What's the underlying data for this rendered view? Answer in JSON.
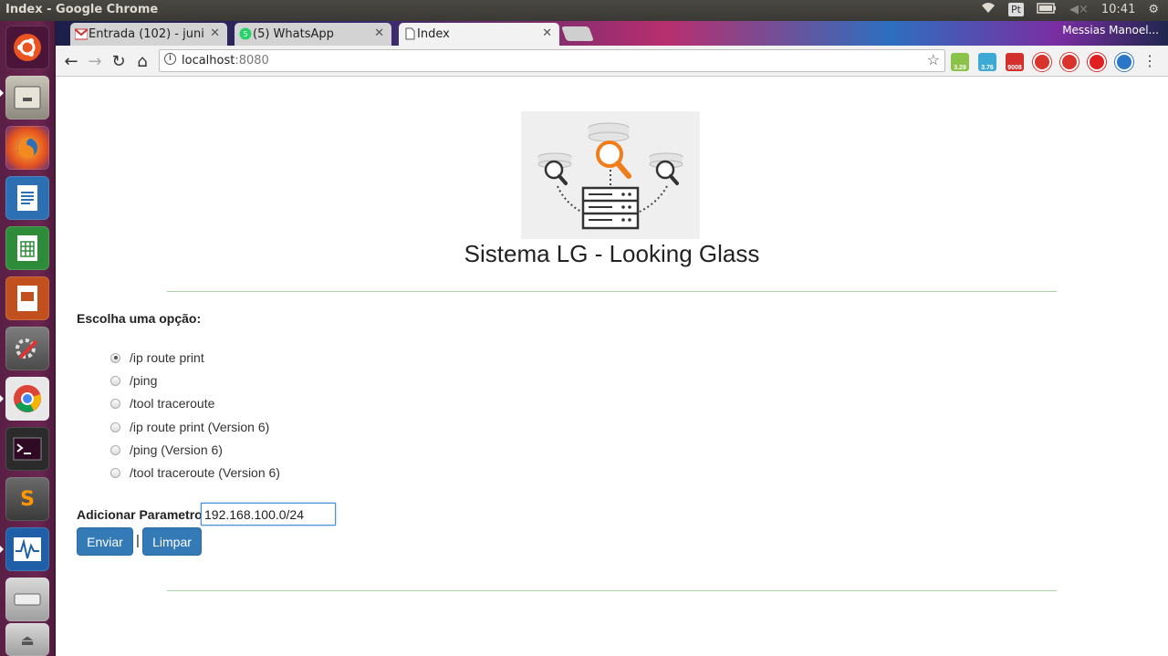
{
  "window": {
    "title": "Index - Google Chrome"
  },
  "tray": {
    "keyboard": "Pt",
    "time": "10:41"
  },
  "tabs": [
    {
      "label": "Entrada (102) - juni",
      "favicon": "gmail-icon"
    },
    {
      "label": "(5) WhatsApp",
      "favicon": "whatsapp-icon"
    },
    {
      "label": "Index",
      "favicon": "page-icon"
    }
  ],
  "profile": "Messias Manoel...",
  "address": {
    "host": "localhost",
    "port": ":8080"
  },
  "extensions": [
    {
      "name": "android-ext-icon",
      "badge": "3.29",
      "color": "#8bc34a"
    },
    {
      "name": "android-ext-icon-2",
      "badge": "3.76",
      "color": "#3fa9d6"
    },
    {
      "name": "gmail-ext-icon",
      "badge": "9008",
      "color": "#d32f2f"
    },
    {
      "name": "ext-icon-red-1",
      "badge": "",
      "color": "#d9342b"
    },
    {
      "name": "ext-icon-red-2",
      "badge": "",
      "color": "#d9342b"
    },
    {
      "name": "opera-ext-icon",
      "badge": "",
      "color": "#e02020"
    },
    {
      "name": "vpn-ext-icon",
      "badge": "",
      "color": "#2a77c9"
    }
  ],
  "page": {
    "heading": "Sistema LG - Looking Glass",
    "choose_label": "Escolha uma opção:",
    "options": [
      {
        "label": "/ip route print",
        "selected": true
      },
      {
        "label": "/ping",
        "selected": false
      },
      {
        "label": "/tool traceroute",
        "selected": false
      },
      {
        "label": "/ip route print (Version 6)",
        "selected": false
      },
      {
        "label": "/ping (Version 6)",
        "selected": false
      },
      {
        "label": "/tool traceroute (Version 6)",
        "selected": false
      }
    ],
    "param_label": "Adicionar Parametro:",
    "param_value": "192.168.100.0/24",
    "send_button": "Enviar",
    "separator": "|",
    "clear_button": "Limpar"
  }
}
